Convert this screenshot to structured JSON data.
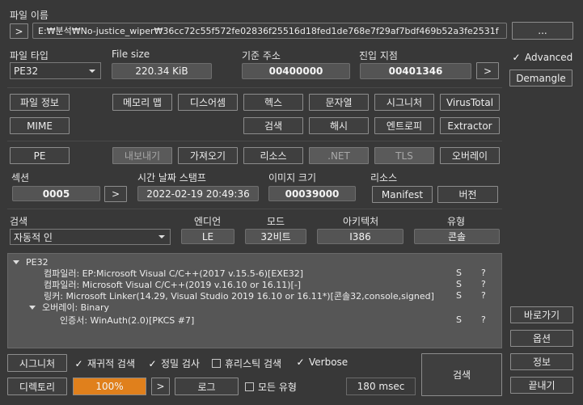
{
  "file_name": {
    "label": "파일 이름",
    "browse_button": ">",
    "path": "E:₩분석₩No-justice_wiper₩36cc72c55f572fe02836f25516d18fed1de768e7f29af7bdf469b52a3fe2531f",
    "more_button": "..."
  },
  "file_type": {
    "label": "파일 타입",
    "selected": "PE32"
  },
  "file_size": {
    "label": "File size",
    "value": "220.34 KiB"
  },
  "base_address": {
    "label": "기준 주소",
    "value": "00400000"
  },
  "entry_point": {
    "label": "진입 지점",
    "value": "00401346",
    "go_button": ">"
  },
  "advanced": {
    "checked_mark": "✓",
    "label": "Advanced"
  },
  "demangle_button": "Demangle",
  "row_buttons_1": [
    "파일 정보",
    "메모리 맵",
    "디스어셈",
    "헥스",
    "문자열",
    "시그니처",
    "VirusTotal"
  ],
  "row_buttons_2": [
    "MIME",
    "검색",
    "해시",
    "엔트로피",
    "Extractor"
  ],
  "pe_tabs": [
    "PE",
    "내보내기",
    "가져오기",
    "리소스",
    ".NET",
    "TLS",
    "오버레이"
  ],
  "sections": {
    "label": "섹션",
    "value": "0005",
    "go_button": ">"
  },
  "timestamp": {
    "label": "시간 날짜 스탬프",
    "value": "2022-02-19 20:49:36"
  },
  "image_size": {
    "label": "이미지 크기",
    "value": "00039000"
  },
  "resources": {
    "label": "리소스",
    "manifest_button": "Manifest",
    "version_button": "버전"
  },
  "scan": {
    "label": "검색",
    "selected": "자동적 인"
  },
  "endian": {
    "label": "엔디언",
    "value": "LE"
  },
  "mode": {
    "label": "모드",
    "value": "32비트"
  },
  "arch": {
    "label": "아키텍처",
    "value": "I386"
  },
  "type": {
    "label": "유형",
    "value": "콘솔"
  },
  "results": [
    {
      "text": "PE32",
      "level": 0,
      "expanded": true,
      "flag": "",
      "q": ""
    },
    {
      "text": "컴파일러: EP:Microsoft Visual C/C++(2017 v.15.5-6)[EXE32]",
      "level": 1,
      "flag": "S",
      "q": "?"
    },
    {
      "text": "컴파일러: Microsoft Visual C/C++(2019 v.16.10 or 16.11)[-]",
      "level": 1,
      "flag": "S",
      "q": "?"
    },
    {
      "text": "링커: Microsoft Linker(14.29, Visual Studio 2019 16.10 or 16.11*)[콘솔32,console,signed]",
      "level": 1,
      "flag": "S",
      "q": "?"
    },
    {
      "text": "오버레이: Binary",
      "level": 1,
      "expanded": true,
      "flag": "",
      "q": ""
    },
    {
      "text": "인증서: WinAuth(2.0)[PKCS #7]",
      "level": 2,
      "flag": "S",
      "q": "?"
    }
  ],
  "side_buttons": [
    "바로가기",
    "옵션",
    "정보",
    "끝내기"
  ],
  "bottom": {
    "signature_button": "시그니처",
    "recursive": {
      "mark": "✓",
      "label": "재귀적 검색"
    },
    "deep": {
      "mark": "✓",
      "label": "정밀 검사"
    },
    "heuristic": {
      "label": "휴리스틱 검색"
    },
    "verbose": {
      "mark": "✓",
      "label": "Verbose"
    },
    "directory_button": "디렉토리",
    "progress_text": "100%",
    "progress_fraction": 1.0,
    "next_button": ">",
    "log_button": "로그",
    "all_types": {
      "label": "모든 유형"
    },
    "time": "180 msec",
    "scan_button": "검색"
  },
  "colors": {
    "progress": "#e0801c",
    "background": "#383838"
  }
}
